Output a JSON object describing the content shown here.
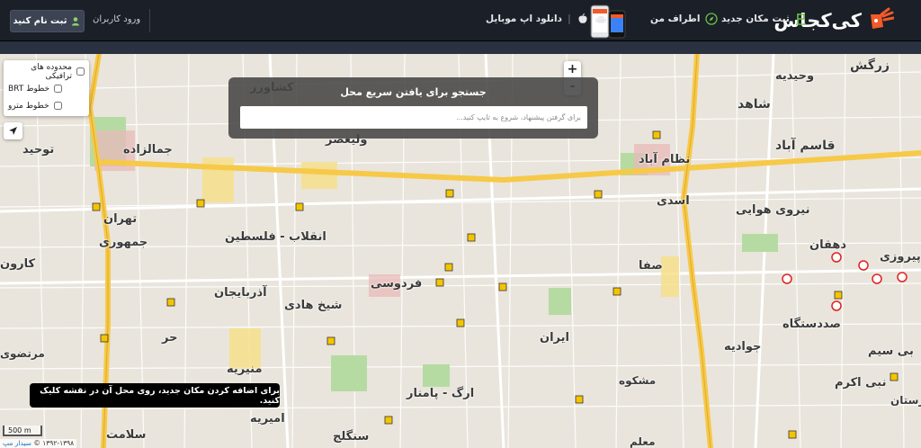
{
  "header": {
    "logo_text": "کی‌کجاس",
    "nav": {
      "add_place": "ثبت مکان جدید",
      "nearby": "اطراف من",
      "download_app": "دانلود اپ موبایل"
    },
    "login": "ورود کاربران",
    "signup": "ثبت نام کنید"
  },
  "layers": {
    "items": [
      "محدوده های ترافیکی",
      "خطوط BRT",
      "خطوط مترو"
    ]
  },
  "zoom": {
    "in": "+",
    "out": "-"
  },
  "search": {
    "title": "جستجو برای یافتن سریع محل",
    "placeholder": "برای گرفتن پیشنهاد، شروع به تایپ کنید..."
  },
  "toast": "برای اضافه کردن مکان جدید، روی محل آن در نقشه کلیک کنید.",
  "scale": "500 m",
  "attribution": {
    "text": "۱۳۹۲-۱۳۹۸ © ",
    "link": "سیدار مپ"
  },
  "map_labels": {
    "zargosh": "زرگش",
    "vahidieh": "وحیدیه",
    "shahed": "شاهد",
    "qasemabad": "قاسم آباد",
    "keshavarz": "کشاورز",
    "tohid": "توحید",
    "jamalzadeh": "جمالزاده",
    "valiasr": "ولیعصر",
    "nezamabad": "نظام آباد",
    "asadi": "اسدی",
    "niroohavaei": "نیروی هوایی",
    "tehran": "تهران",
    "enghelab": "انقلاب - فلسطین",
    "jomhoori": "جمهوری",
    "safa": "صفا",
    "dehghan": "دهقان",
    "piroozi": "پیروزی",
    "karoon": "کارون",
    "azarbaijan": "آذربایجان",
    "ferdowsi": "فردوسی",
    "shikhhadi": "شیخ هادی",
    "seddastgah": "صددستگاه",
    "hor": "حر",
    "iran": "ایران",
    "javadieh": "جوادیه",
    "morteza": "مرتضوی",
    "monirieh": "منیریه",
    "arg": "ارگ - پامنار",
    "bisim": "بی سیم",
    "nabiakram": "نبی اکرم",
    "baharestan": "بهارستان",
    "amirieh": "امیریه",
    "salamat": "سلامت",
    "sanglaj": "سنگلج",
    "moalem": "معلم",
    "moshkooh": "مشکوه"
  },
  "colors": {
    "header_bg": "#1b1f27",
    "logo_accent": "#f15a29",
    "highway": "#f7c948",
    "map_bg": "#e9e5dc",
    "park": "#b5dba3",
    "camera": "#f5c400"
  }
}
